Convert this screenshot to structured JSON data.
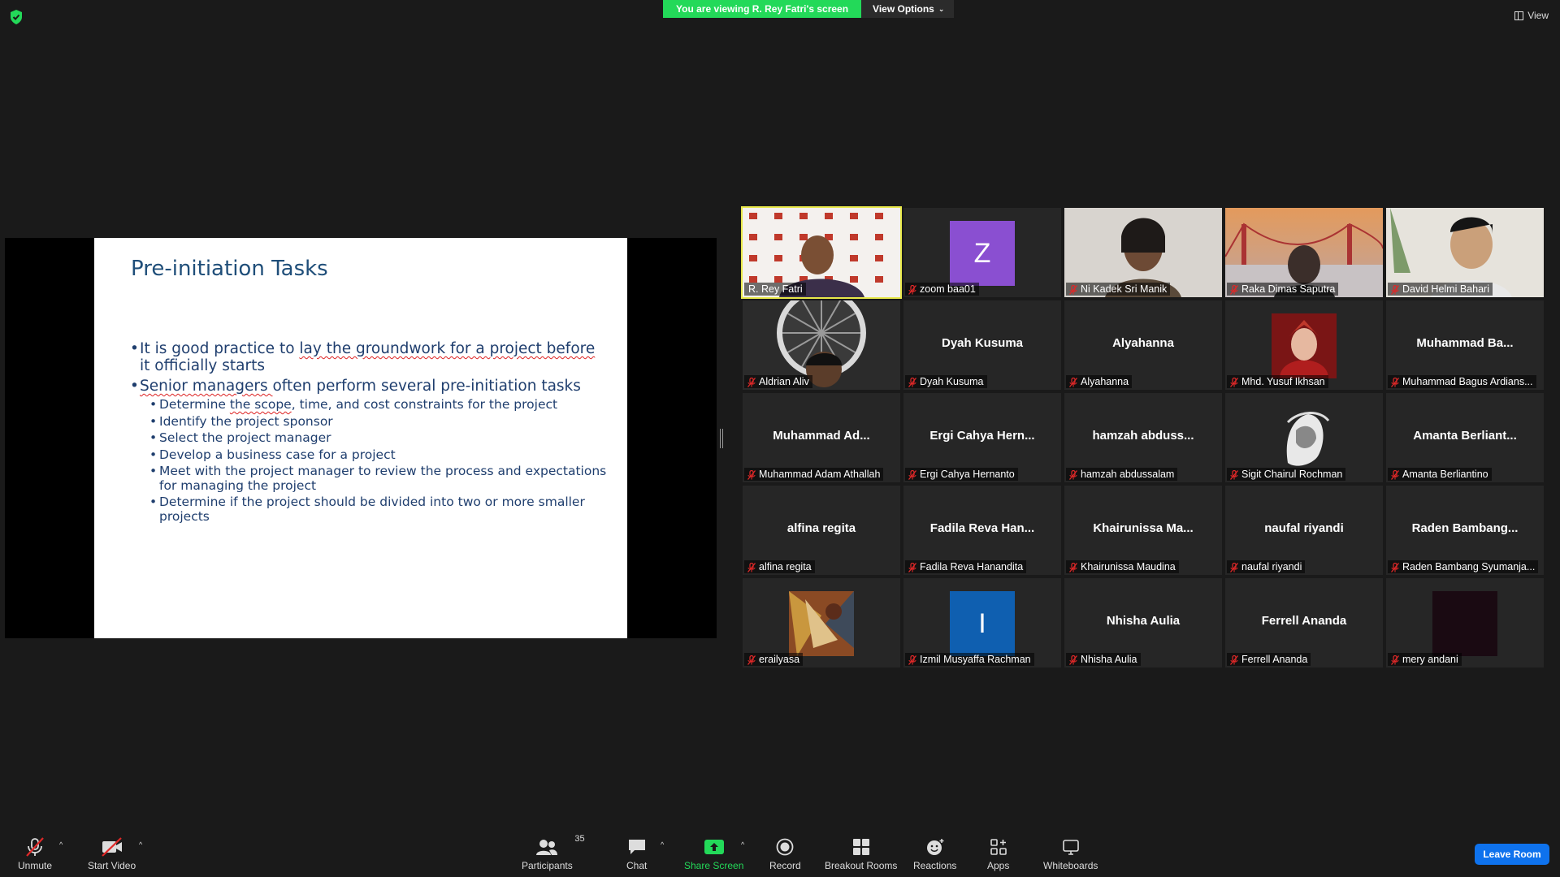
{
  "banner": {
    "viewing_text": "You are viewing R. Rey Fatri's screen",
    "view_options": "View Options"
  },
  "top_right": {
    "view_label": "View"
  },
  "slide": {
    "title": "Pre-initiation Tasks",
    "bullet1_part1": "It is good practice to ",
    "bullet1_underlined": "lay the groundwork for a project before",
    "bullet1_part2": " it officially starts",
    "bullet2_underlined": "Senior managers ",
    "bullet2_part2": "often perform several pre-initiation tasks",
    "sub1_part1": "Determine ",
    "sub1_underlined": "the scope",
    "sub1_part2": ", time, and cost constraints for the project",
    "sub2": "Identify the project sponsor",
    "sub3": "Select the project manager",
    "sub4": "Develop a business case for a project",
    "sub5": "Meet with the project manager to review the process and expectations for managing the project",
    "sub6": "Determine if the project should be divided into two or more smaller projects"
  },
  "participants": [
    {
      "tag": "R. Rey Fatri",
      "big": "",
      "muted": false,
      "kind": "video-host"
    },
    {
      "tag": "zoom baa01",
      "big": "",
      "letter": "Z",
      "letter_color": "#8a4fd1",
      "muted": true,
      "kind": "letter"
    },
    {
      "tag": "Ni Kadek Sri Manik",
      "big": "",
      "muted": true,
      "kind": "video-face"
    },
    {
      "tag": "Raka Dimas Saputra",
      "big": "",
      "muted": true,
      "kind": "video-bridge"
    },
    {
      "tag": "David Helmi Bahari",
      "big": "",
      "muted": true,
      "kind": "video-room"
    },
    {
      "tag": "Aldrian Aliv",
      "big": "",
      "muted": true,
      "kind": "video-fan"
    },
    {
      "tag": "Dyah Kusuma",
      "big": "Dyah Kusuma",
      "muted": true,
      "kind": "name"
    },
    {
      "tag": "Alyahanna",
      "big": "Alyahanna",
      "muted": true,
      "kind": "name"
    },
    {
      "tag": "Mhd. Yusuf Ikhsan",
      "big": "",
      "muted": true,
      "kind": "avatar-red"
    },
    {
      "tag": "Muhammad Bagus Ardians...",
      "big": "Muhammad  Ba...",
      "muted": true,
      "kind": "name"
    },
    {
      "tag": "Muhammad Adam Athallah",
      "big": "Muhammad  Ad...",
      "muted": true,
      "kind": "name"
    },
    {
      "tag": "Ergi Cahya Hernanto",
      "big": "Ergi  Cahya  Hern...",
      "muted": true,
      "kind": "name"
    },
    {
      "tag": "hamzah abdussalam",
      "big": "hamzah  abduss...",
      "muted": true,
      "kind": "name"
    },
    {
      "tag": "Sigit Chairul Rochman",
      "big": "",
      "muted": true,
      "kind": "avatar-lion"
    },
    {
      "tag": "Amanta Berliantino",
      "big": "Amanta  Berliant...",
      "muted": true,
      "kind": "name"
    },
    {
      "tag": "alfina regita",
      "big": "alfina regita",
      "muted": true,
      "kind": "name"
    },
    {
      "tag": "Fadila Reva Hanandita",
      "big": "Fadila  Reva  Han...",
      "muted": true,
      "kind": "name"
    },
    {
      "tag": "Khairunissa Maudina",
      "big": "Khairunissa  Ma...",
      "muted": true,
      "kind": "name"
    },
    {
      "tag": "naufal riyandi",
      "big": "naufal riyandi",
      "muted": true,
      "kind": "name"
    },
    {
      "tag": "Raden Bambang Syumanja...",
      "big": "Raden  Bambang...",
      "muted": true,
      "kind": "name"
    },
    {
      "tag": "erailyasa",
      "big": "",
      "muted": true,
      "kind": "avatar-art"
    },
    {
      "tag": "Izmil Musyaffa Rachman",
      "big": "",
      "letter": "I",
      "letter_color": "#0f5fb0",
      "muted": true,
      "kind": "letter"
    },
    {
      "tag": "Nhisha Aulia",
      "big": "Nhisha Aulia",
      "muted": true,
      "kind": "name"
    },
    {
      "tag": "Ferrell Ananda",
      "big": "Ferrell Ananda",
      "muted": true,
      "kind": "name"
    },
    {
      "tag": "mery andani",
      "big": "",
      "muted": true,
      "kind": "avatar-dark"
    }
  ],
  "toolbar": {
    "unmute": "Unmute",
    "start_video": "Start Video",
    "participants": "Participants",
    "participants_count": "35",
    "chat": "Chat",
    "share_screen": "Share Screen",
    "record": "Record",
    "breakout_rooms": "Breakout Rooms",
    "reactions": "Reactions",
    "apps": "Apps",
    "whiteboards": "Whiteboards",
    "leave_room": "Leave Room"
  },
  "colors": {
    "share_green": "#23d959",
    "leave_blue": "#0e72ed",
    "active_speaker": "#e8e84a",
    "mute_red": "#e02828"
  }
}
